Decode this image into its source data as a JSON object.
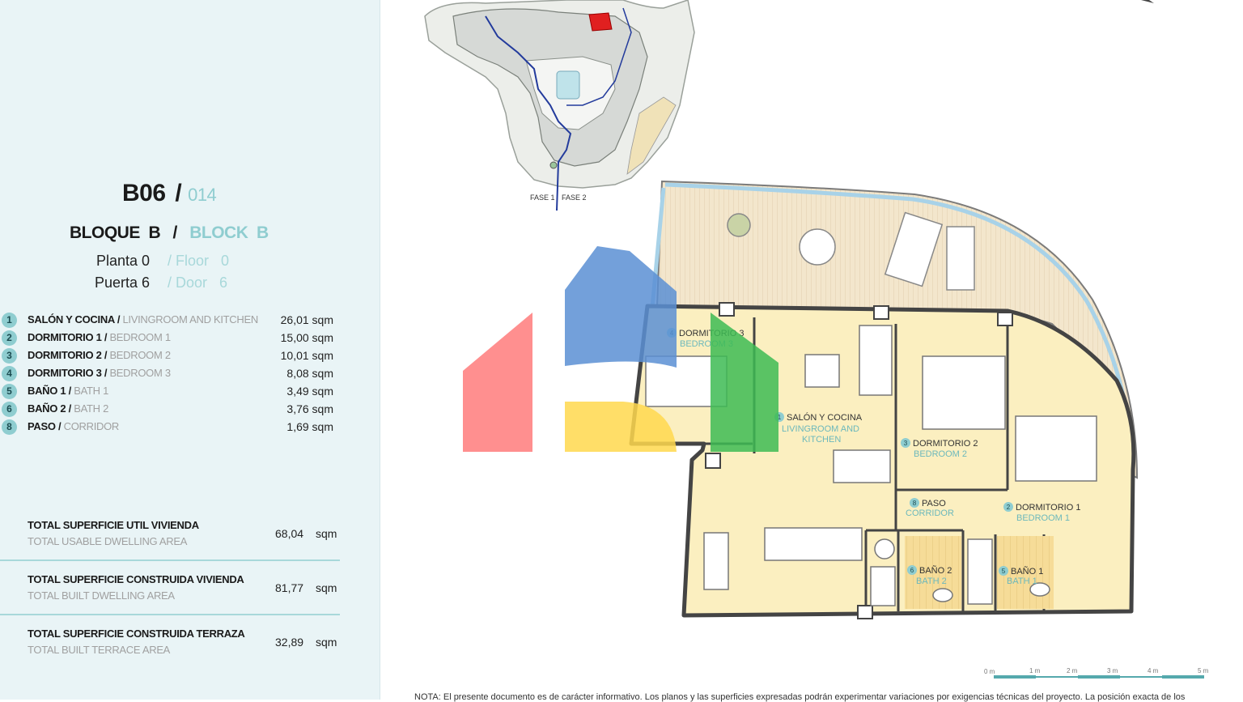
{
  "header": {
    "unit_code": "B06",
    "unit_sep": "/",
    "unit_number": "014",
    "block_es": "BLOQUE  B",
    "block_sep": "/",
    "block_en": "BLOCK  B",
    "floor_es": "Planta 0",
    "floor_en": "/ Floor   0",
    "door_es": "Puerta 6",
    "door_en": "/ Door   6"
  },
  "rooms": [
    {
      "num": "1",
      "es": "SALÓN Y COCINA / ",
      "en": "LIVINGROOM AND KITCHEN",
      "area": "26,01 sqm"
    },
    {
      "num": "2",
      "es": "DORMITORIO 1 / ",
      "en": "BEDROOM 1",
      "area": "15,00 sqm"
    },
    {
      "num": "3",
      "es": "DORMITORIO 2 / ",
      "en": "BEDROOM 2",
      "area": "10,01 sqm"
    },
    {
      "num": "4",
      "es": "DORMITORIO 3 / ",
      "en": "BEDROOM 3",
      "area": "8,08 sqm"
    },
    {
      "num": "5",
      "es": "BAÑO 1 / ",
      "en": "BATH 1",
      "area": "3,49 sqm"
    },
    {
      "num": "6",
      "es": "BAÑO 2 / ",
      "en": "BATH 2",
      "area": "3,76 sqm"
    },
    {
      "num": "8",
      "es": "PASO / ",
      "en": "CORRIDOR",
      "area": "1,69 sqm"
    }
  ],
  "totals": [
    {
      "es": "TOTAL SUPERFICIE UTIL VIVIENDA",
      "en": "TOTAL USABLE DWELLING AREA",
      "value": "68,04",
      "unit": "sqm"
    },
    {
      "es": "TOTAL SUPERFICIE CONSTRUIDA VIVIENDA",
      "en": "TOTAL BUILT DWELLING AREA",
      "value": "81,77",
      "unit": "sqm"
    },
    {
      "es": "TOTAL SUPERFICIE CONSTRUIDA TERRAZA",
      "en": "TOTAL BUILT TERRACE AREA",
      "value": "32,89",
      "unit": "sqm"
    }
  ],
  "site_plan": {
    "phase1": "FASE 1",
    "phase2": "FASE 2"
  },
  "plan_labels": {
    "r4_num": "4",
    "r4_es": "DORMITORIO 3",
    "r4_en": "BEDROOM 3",
    "r1_num": "1",
    "r1_es": "SALÓN Y COCINA",
    "r1_en1": "LIVINGROOM AND",
    "r1_en2": "KITCHEN",
    "r3_num": "3",
    "r3_es": "DORMITORIO 2",
    "r3_en": "BEDROOM 2",
    "r8_num": "8",
    "r8_es": "PASO",
    "r8_en": "CORRIDOR",
    "r2_num": "2",
    "r2_es": "DORMITORIO 1",
    "r2_en": "BEDROOM 1",
    "r6_num": "6",
    "r6_es": "BAÑO 2",
    "r6_en": "BATH 2",
    "r5_num": "5",
    "r5_es": "BAÑO 1",
    "r5_en": "BATH 1"
  },
  "scale_bar": {
    "ticks": [
      "0 m",
      "1 m",
      "2 m",
      "3 m",
      "4 m",
      "5 m"
    ]
  },
  "footnote": "NOTA: El presente documento es de carácter informativo. Los planos y las superficies expresadas podrán experimentar variaciones por exigencias técnicas del proyecto. La posición exacta de los",
  "colors": {
    "accent": "#8fcdd0",
    "room_fill": "#fbefc0",
    "terrace_fill": "#f2e4c8",
    "logo_red": "#ff7b7b",
    "logo_blue": "#5b8fd4",
    "logo_yellow": "#ffd84d",
    "logo_green": "#3dbb53"
  },
  "icons": [
    "house-logo-watermark",
    "compass-icon"
  ]
}
